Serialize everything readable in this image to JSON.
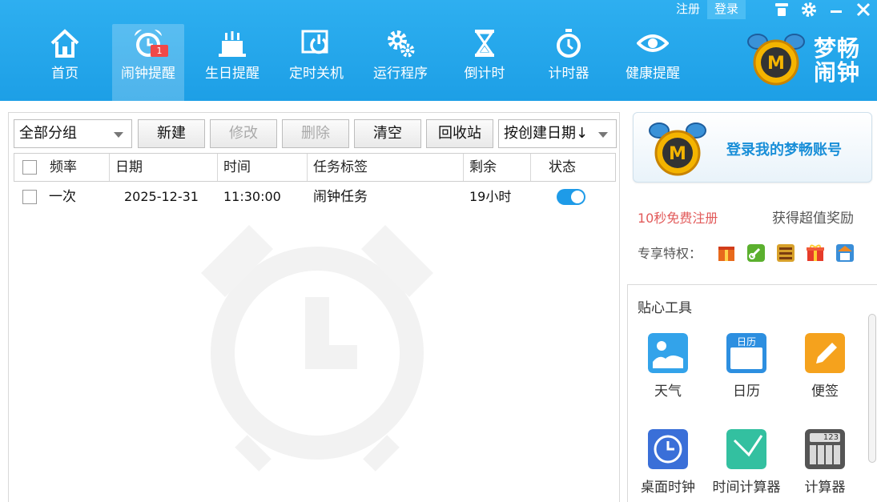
{
  "window": {
    "register_label": "注册",
    "login_label": "登录",
    "icons": [
      "skin-icon",
      "gear-icon",
      "minimize-icon",
      "close-icon"
    ]
  },
  "nav": {
    "items": [
      {
        "label": "首页",
        "icon": "home-icon"
      },
      {
        "label": "闹钟提醒",
        "icon": "alarm-clock-icon",
        "badge": "1",
        "active": true
      },
      {
        "label": "生日提醒",
        "icon": "birthday-cake-icon"
      },
      {
        "label": "定时关机",
        "icon": "power-icon"
      },
      {
        "label": "运行程序",
        "icon": "gears-icon"
      },
      {
        "label": "倒计时",
        "icon": "hourglass-icon"
      },
      {
        "label": "计时器",
        "icon": "stopwatch-icon"
      },
      {
        "label": "健康提醒",
        "icon": "eye-icon"
      }
    ]
  },
  "brand": {
    "line1": "梦畅",
    "line2": "闹钟"
  },
  "toolbar": {
    "group_select": "全部分组",
    "new_label": "新建",
    "edit_label": "修改",
    "delete_label": "删除",
    "clear_label": "清空",
    "recycle_label": "回收站",
    "sort_select": "按创建日期↓"
  },
  "table": {
    "columns": [
      "频率",
      "日期",
      "时间",
      "任务标签",
      "剩余",
      "状态"
    ],
    "rows": [
      {
        "frequency": "一次",
        "date": "2025-12-31",
        "time": "11:30:00",
        "label": "闹钟任务",
        "remaining": "19小时",
        "enabled": true
      }
    ]
  },
  "account": {
    "login_text": "登录我的梦畅账号",
    "register_text": "10秒免费注册",
    "reward_text": "获得超值奖励",
    "privileges_label": "专享特权："
  },
  "tools": {
    "title": "贴心工具",
    "items": [
      {
        "label": "天气",
        "icon": "weather-icon"
      },
      {
        "label": "日历",
        "icon": "calendar-icon",
        "icon_text": "日历"
      },
      {
        "label": "便签",
        "icon": "notepad-icon"
      },
      {
        "label": "桌面时钟",
        "icon": "desktop-clock-icon"
      },
      {
        "label": "时间计算器",
        "icon": "time-calculator-icon"
      },
      {
        "label": "计算器",
        "icon": "calculator-icon",
        "icon_text": "123"
      }
    ]
  },
  "colors": {
    "header": "#23a8ec",
    "accent": "#1e9be8",
    "register": "#e25a5a",
    "badge": "#f04848"
  }
}
